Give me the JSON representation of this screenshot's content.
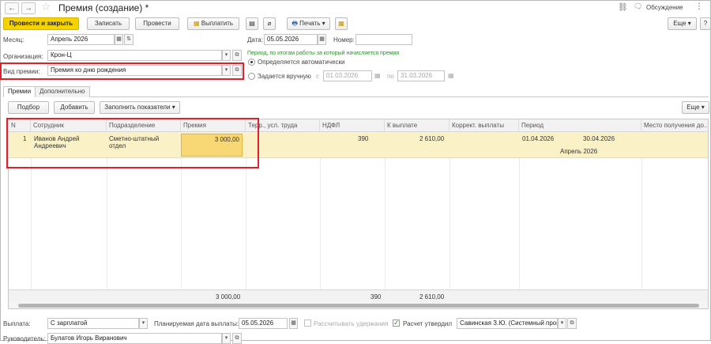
{
  "window": {
    "title": "Премия (создание) *",
    "discussion_label": "Обсуждение",
    "more_glyph": "⋮",
    "back_glyph": "←",
    "forward_glyph": "→",
    "star_glyph": "☆",
    "link_glyph": "⛓",
    "chat_glyph": "🗨"
  },
  "toolbar": {
    "post_and_close": "Провести и закрыть",
    "save": "Записать",
    "post": "Провести",
    "pay": "Выплатить",
    "print": "Печать",
    "more": "Еще",
    "help": "?",
    "dropdown_glyph": "▾",
    "doc_icon_glyph": "▤",
    "clip_icon_glyph": "⌀",
    "printer_glyph": "🖶",
    "report_glyph": "▦"
  },
  "form": {
    "month_label": "Месяц:",
    "month_value": "Апрель 2026",
    "date_label": "Дата:",
    "date_value": "05.05.2026",
    "number_label": "Номер:",
    "number_value": "",
    "org_label": "Организация:",
    "org_value": "Крон-Ц",
    "bonus_type_label": "Вид премии:",
    "bonus_type_value": "Премия ко дню рождения",
    "period_note": "Период, по итогам работы за который начисляется премия",
    "radio_auto": "Определяется автоматически",
    "radio_manual": "Задается вручную",
    "from_label": "с",
    "from_value": "01.03.2026",
    "to_label": "по",
    "to_value": "31.03.2026",
    "calendar_glyph": "▦",
    "open_glyph": "⧉",
    "updown_glyph": "⇅"
  },
  "tabs": [
    {
      "label": "Премии",
      "active": true
    },
    {
      "label": "Дополнительно",
      "active": false
    }
  ],
  "table_toolbar": {
    "select": "Подбор",
    "add": "Добавить",
    "fill": "Заполнить показатели",
    "more": "Еще"
  },
  "table": {
    "columns": [
      "N",
      "Сотрудник",
      "Подразделение",
      "Премия",
      "Терр., усл. труда",
      "НДФЛ",
      "К выплате",
      "Коррект. выплаты",
      "Период",
      "Место получения до..."
    ],
    "rows": [
      {
        "n": "1",
        "employee_line1": "Иванов Андрей",
        "employee_line2": "Андреевич",
        "department_line1": "Сметно-штатный",
        "department_line2": "отдел",
        "bonus": "3 000,00",
        "terr": "",
        "ndfl": "390",
        "payout": "2 610,00",
        "correction": "",
        "period_from": "01.04.2026",
        "period_to": "30.04.2026",
        "period_month": "Апрель 2026"
      }
    ],
    "totals": {
      "bonus": "3 000,00",
      "ndfl": "390",
      "payout": "2 610,00"
    }
  },
  "bottom": {
    "payout_label": "Выплата:",
    "payout_value": "С зарплатой",
    "planned_date_label": "Планируемая дата выплаты:",
    "planned_date_value": "05.05.2026",
    "calc_deductions": "Рассчитывать удержания",
    "calc_approved": "Расчет утвердил",
    "approver_value": "Савинская З.Ю. (Системный прог",
    "manager_label": "Руководитель:",
    "manager_value": "Булатов Игорь Виранович",
    "check_glyph": "✓"
  },
  "colors": {
    "primary_button": "#f5d300",
    "highlight_row": "#fbf1c6",
    "active_cell": "#f8d874",
    "annotation_red": "#e0202a",
    "green_text": "#2f8f2f"
  }
}
